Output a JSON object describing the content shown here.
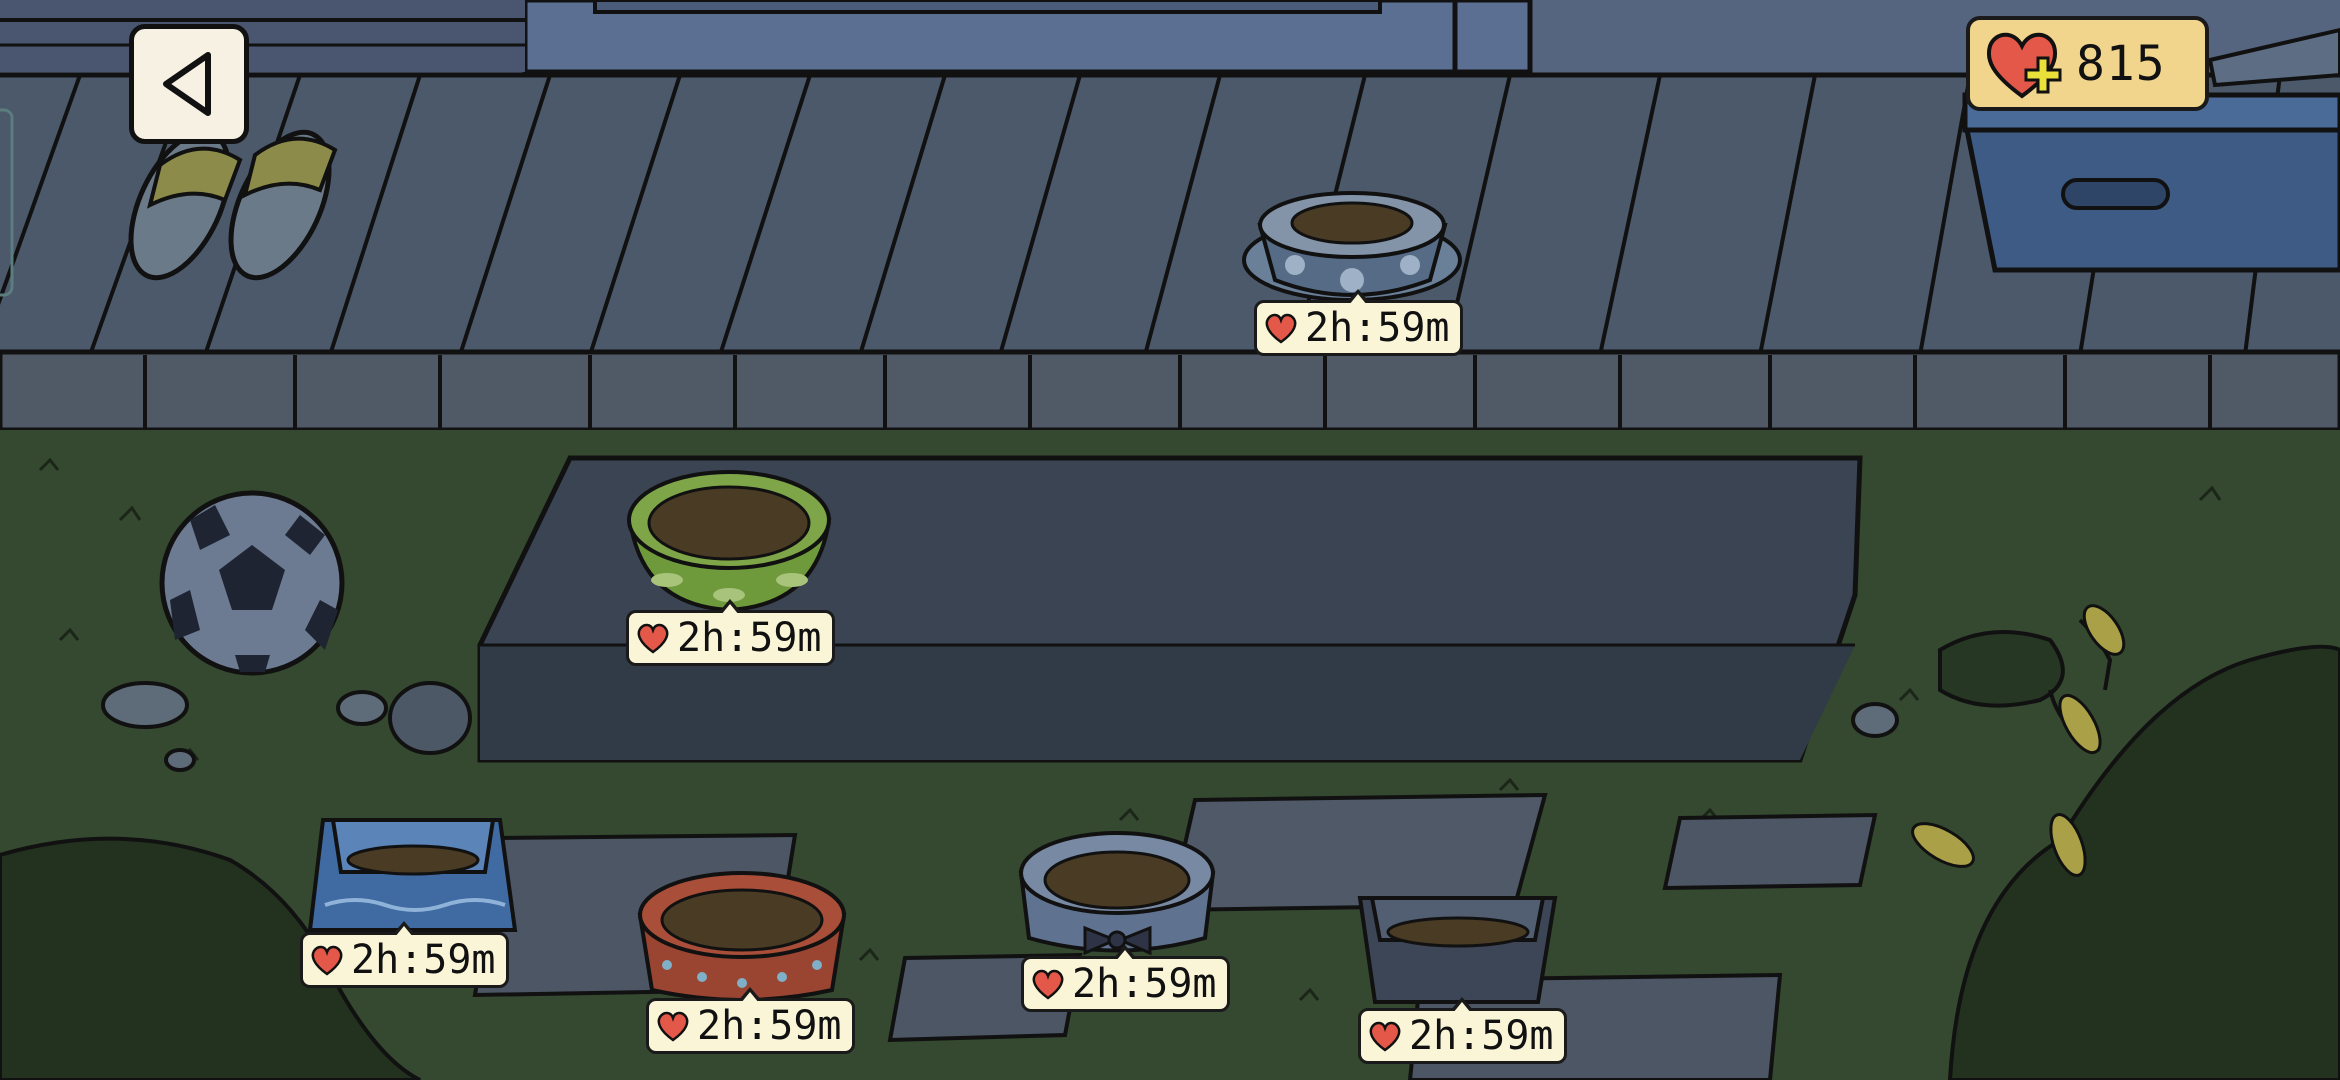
{
  "hud": {
    "back_icon": "back-arrow-icon",
    "hearts_icon": "heart-plus-icon",
    "hearts_count": "815"
  },
  "bowls": [
    {
      "name": "porch-bowl-spotted",
      "timer": "2h:59m"
    },
    {
      "name": "step-bowl-green",
      "timer": "2h:59m"
    },
    {
      "name": "yard-bowl-blue-square",
      "timer": "2h:59m"
    },
    {
      "name": "yard-bowl-red-dotted",
      "timer": "2h:59m"
    },
    {
      "name": "yard-bowl-ribbon",
      "timer": "2h:59m"
    },
    {
      "name": "yard-bowl-dark-square",
      "timer": "2h:59m"
    }
  ],
  "colors": {
    "timer_bg": "#fbf5d8",
    "heart": "#e4584a",
    "hearts_panel": "#f2d58d"
  }
}
